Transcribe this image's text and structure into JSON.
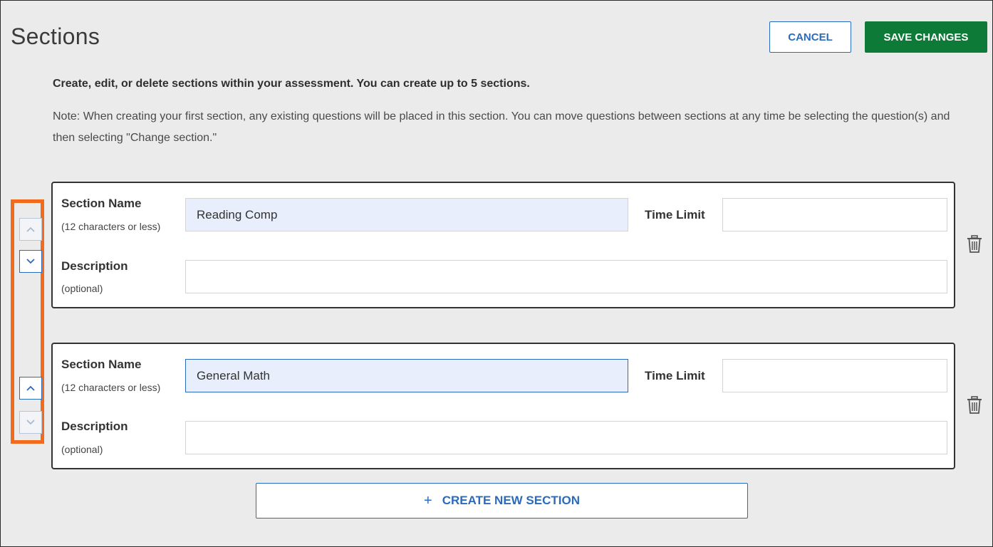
{
  "page": {
    "title": "Sections",
    "cancel_label": "CANCEL",
    "save_label": "SAVE CHANGES",
    "intro": "Create, edit, or delete sections within your assessment. You can create up to 5 sections.",
    "note": "Note: When creating your first section, any existing questions will be placed in this section. You can move questions between sections at any time be selecting the question(s) and then selecting \"Change section.\""
  },
  "colors": {
    "accent": "#2a6bbd",
    "save_button": "#0e7a37",
    "highlight_border": "#f26b1d",
    "name_field_bg": "#e8eefb",
    "page_bg": "#ebebeb"
  },
  "sections": [
    {
      "name_label": "Section Name",
      "name_hint": "(12 characters or less)",
      "name_value": "Reading Comp",
      "time_limit_label": "Time Limit",
      "time_limit_value": "",
      "description_label": "Description",
      "description_hint": "(optional)",
      "description_value": "",
      "move_up_enabled": false,
      "move_down_enabled": true,
      "icons": {
        "move_up": "chevron-up-icon",
        "move_down": "chevron-down-icon",
        "delete": "trash-icon"
      }
    },
    {
      "name_label": "Section Name",
      "name_hint": "(12 characters or less)",
      "name_value": "General Math",
      "time_limit_label": "Time Limit",
      "time_limit_value": "",
      "description_label": "Description",
      "description_hint": "(optional)",
      "description_value": "",
      "move_up_enabled": true,
      "move_down_enabled": false,
      "icons": {
        "move_up": "chevron-up-icon",
        "move_down": "chevron-down-icon",
        "delete": "trash-icon"
      }
    }
  ],
  "create_button": {
    "icon": "plus-icon",
    "plus_symbol": "+",
    "label": "CREATE NEW SECTION"
  }
}
